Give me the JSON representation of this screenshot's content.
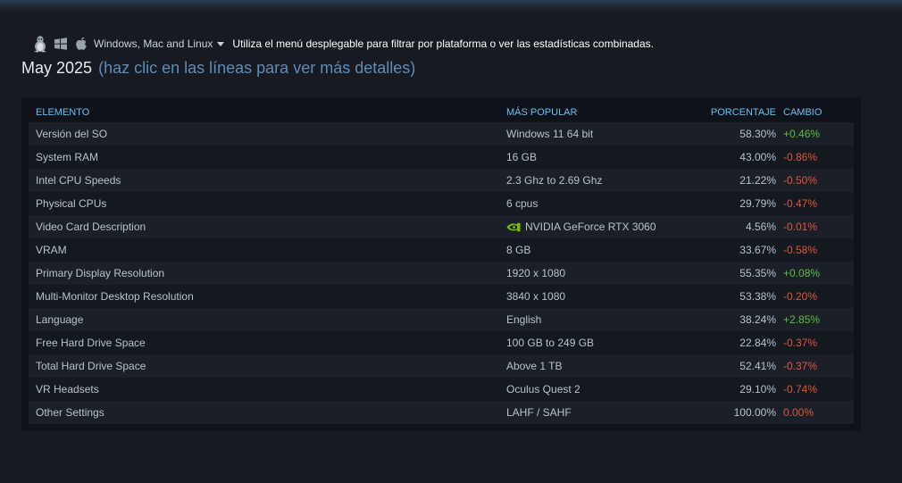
{
  "platform": {
    "icons": [
      "linux-icon",
      "windows-icon",
      "apple-icon"
    ],
    "selected": "Windows, Mac and Linux",
    "hint": "Utiliza el menú desplegable para filtrar por plataforma o ver las estadísticas combinadas."
  },
  "heading": {
    "month": "May 2025",
    "subtitle": "(haz clic en las líneas para ver más detalles)"
  },
  "table": {
    "headers": {
      "item": "ELEMENTO",
      "popular": "MÁS POPULAR",
      "percent": "PORCENTAJE",
      "change": "CAMBIO"
    },
    "rows": [
      {
        "item": "Versión del SO",
        "popular": "Windows 11 64 bit",
        "percent": "58.30%",
        "change": "+0.46%",
        "trend": "up"
      },
      {
        "item": "System RAM",
        "popular": "16 GB",
        "percent": "43.00%",
        "change": "-0.86%",
        "trend": "down"
      },
      {
        "item": "Intel CPU Speeds",
        "popular": "2.3 Ghz to 2.69 Ghz",
        "percent": "21.22%",
        "change": "-0.50%",
        "trend": "down"
      },
      {
        "item": "Physical CPUs",
        "popular": "6 cpus",
        "percent": "29.79%",
        "change": "-0.47%",
        "trend": "down"
      },
      {
        "item": "Video Card Description",
        "popular": "NVIDIA GeForce RTX 3060",
        "percent": "4.56%",
        "change": "-0.01%",
        "trend": "down",
        "icon": "nvidia-icon"
      },
      {
        "item": "VRAM",
        "popular": "8 GB",
        "percent": "33.67%",
        "change": "-0.58%",
        "trend": "down"
      },
      {
        "item": "Primary Display Resolution",
        "popular": "1920 x 1080",
        "percent": "55.35%",
        "change": "+0.08%",
        "trend": "up"
      },
      {
        "item": "Multi-Monitor Desktop Resolution",
        "popular": "3840 x 1080",
        "percent": "53.38%",
        "change": "-0.20%",
        "trend": "down"
      },
      {
        "item": "Language",
        "popular": "English",
        "percent": "38.24%",
        "change": "+2.85%",
        "trend": "up"
      },
      {
        "item": "Free Hard Drive Space",
        "popular": "100 GB to 249 GB",
        "percent": "22.84%",
        "change": "-0.37%",
        "trend": "down"
      },
      {
        "item": "Total Hard Drive Space",
        "popular": "Above 1 TB",
        "percent": "52.41%",
        "change": "-0.37%",
        "trend": "down"
      },
      {
        "item": "VR Headsets",
        "popular": "Oculus Quest 2",
        "percent": "29.10%",
        "change": "-0.74%",
        "trend": "down"
      },
      {
        "item": "Other Settings",
        "popular": "LAHF / SAHF",
        "percent": "100.00%",
        "change": "0.00%",
        "trend": "down"
      }
    ]
  },
  "colors": {
    "background": "#181a21",
    "panel": "#0f1218",
    "header_text": "#66c0f4",
    "subtitle": "#5c8db8",
    "positive": "#59bf40",
    "negative": "#e0553a"
  }
}
